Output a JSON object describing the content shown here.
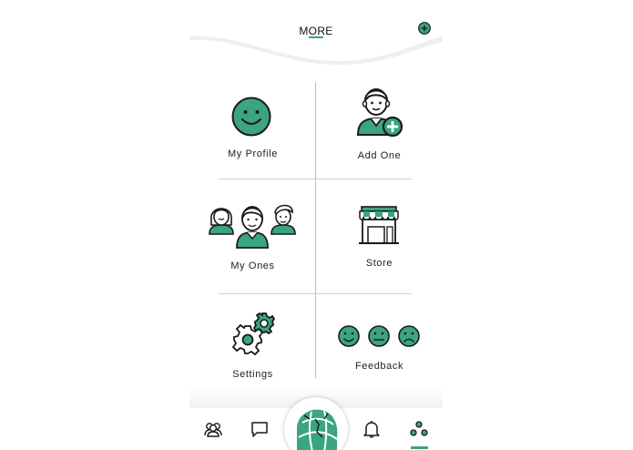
{
  "header": {
    "title": "MORE"
  },
  "tiles": {
    "my_profile": "My Profile",
    "add_one": "Add One",
    "my_ones": "My Ones",
    "store": "Store",
    "settings": "Settings",
    "feedback": "Feedback"
  },
  "tabbar": {
    "items": [
      "people-icon",
      "chat-icon",
      "home-globe-logo",
      "bell-icon",
      "more-dots-icon"
    ],
    "active": "more-dots-icon"
  },
  "colors": {
    "accent": "#3aa57f",
    "outline": "#1a1a1a"
  }
}
